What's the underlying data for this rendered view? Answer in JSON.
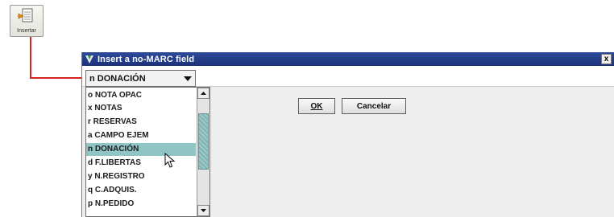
{
  "toolbar": {
    "insert_button_label": "Insertar"
  },
  "dialog": {
    "title": "Insert a no-MARC field",
    "close_glyph": "x",
    "combo_value": "n DONACIÓN",
    "ok_label": "OK",
    "cancel_label": "Cancelar"
  },
  "dropdown": {
    "selected_index": 4,
    "items": [
      "o NOTA OPAC",
      "x NOTAS",
      "r RESERVAS",
      "a CAMPO EJEM",
      "n DONACIÓN",
      "d F.LIBERTAS",
      "y N.REGISTRO",
      "q C.ADQUIS.",
      "p N.PEDIDO"
    ]
  },
  "colors": {
    "title_bar": "#1d3279",
    "selection": "#8fc5c5",
    "connector": "#d42020"
  },
  "icons": {
    "toolbar_icon": "insert-icon",
    "dialog_icon": "app-v-icon"
  }
}
